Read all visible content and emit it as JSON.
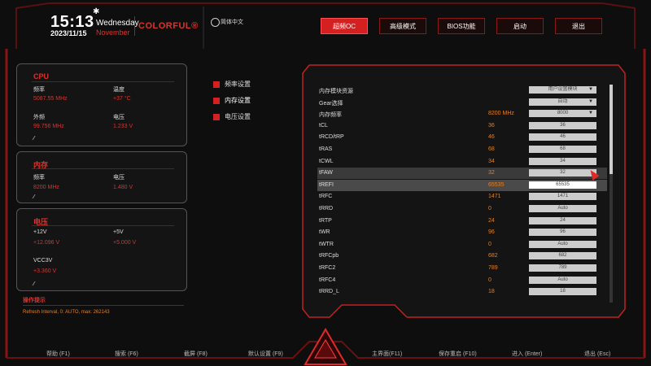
{
  "header": {
    "time": "15:13",
    "date": "2023/11/15",
    "weekday": "Wednesday",
    "month": "November",
    "brand": "COLORFUL®",
    "language": "简体中文"
  },
  "nav": [
    {
      "label": "超频OC",
      "active": true
    },
    {
      "label": "高级模式",
      "active": false
    },
    {
      "label": "BIOS功能",
      "active": false
    },
    {
      "label": "启动",
      "active": false
    },
    {
      "label": "退出",
      "active": false
    }
  ],
  "cpu_panel": {
    "title": "CPU",
    "freq_label": "频率",
    "freq_value": "5087.55 MHz",
    "temp_label": "温度",
    "temp_value": "+37 °C",
    "bclk_label": "外频",
    "bclk_value": "99.756 MHz",
    "volt_label": "电压",
    "volt_value": "1.233 V"
  },
  "mem_panel": {
    "title": "内存",
    "freq_label": "频率",
    "freq_value": "8200 MHz",
    "volt_label": "电压",
    "volt_value": "1.480 V"
  },
  "volt_panel": {
    "title": "电压",
    "v12_label": "+12V",
    "v12_value": "+12.096 V",
    "v5_label": "+5V",
    "v5_value": "+5.000 V",
    "vcc3_label": "VCC3V",
    "vcc3_value": "+3.360 V"
  },
  "menu": [
    {
      "label": "频率设置"
    },
    {
      "label": "内存设置"
    },
    {
      "label": "电压设置"
    }
  ],
  "table_rows": [
    {
      "name": "内存模块资源",
      "current": "",
      "setting": "用户设置模块",
      "dropdown": true
    },
    {
      "name": "Gear选择",
      "current": "",
      "setting": "自动",
      "dropdown": true
    },
    {
      "name": "内存频率",
      "current": "8200 MHz",
      "setting": "8000",
      "dropdown": true
    },
    {
      "name": "tCL",
      "current": "36",
      "setting": "36"
    },
    {
      "name": "tRCD/tRP",
      "current": "46",
      "setting": "46"
    },
    {
      "name": "tRAS",
      "current": "68",
      "setting": "68"
    },
    {
      "name": "tCWL",
      "current": "34",
      "setting": "34"
    },
    {
      "name": "tFAW",
      "current": "32",
      "setting": "32"
    },
    {
      "name": "tREFI",
      "current": "65535",
      "setting": "65535"
    },
    {
      "name": "tRFC",
      "current": "1471",
      "setting": "1471"
    },
    {
      "name": "tRRD",
      "current": "0",
      "setting": "Auto"
    },
    {
      "name": "tRTP",
      "current": "24",
      "setting": "24"
    },
    {
      "name": "tWR",
      "current": "96",
      "setting": "96"
    },
    {
      "name": "tWTR",
      "current": "0",
      "setting": "Auto"
    },
    {
      "name": "tRFCpb",
      "current": "682",
      "setting": "682"
    },
    {
      "name": "tRFC2",
      "current": "789",
      "setting": "789"
    },
    {
      "name": "tRFC4",
      "current": "0",
      "setting": "Auto"
    },
    {
      "name": "tRRD_L",
      "current": "18",
      "setting": "18"
    }
  ],
  "operation": {
    "title": "操作提示",
    "text": "Refresh Interval, 0: AUTO, max: 262143"
  },
  "footer": [
    {
      "label": "帮助 (F1)"
    },
    {
      "label": "搜索 (F6)"
    },
    {
      "label": "截屏 (F8)"
    },
    {
      "label": "默认设置 (F9)"
    },
    {
      "label": "主界面(F11)"
    },
    {
      "label": "保存重启 (F10)"
    },
    {
      "label": "进入 (Enter)"
    },
    {
      "label": "退出 (Esc)"
    }
  ],
  "colors": {
    "accent": "#d42020",
    "value_red": "#e0302a",
    "value_orange": "#e0802a",
    "background": "#0e0e0e"
  }
}
